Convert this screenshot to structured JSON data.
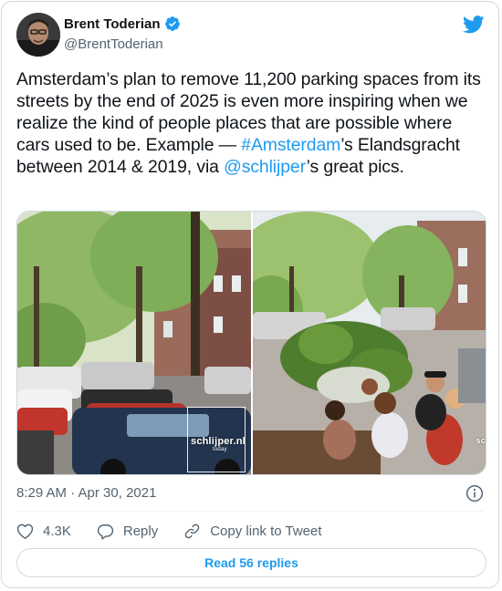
{
  "author": {
    "name": "Brent Toderian",
    "handle": "@BrentToderian"
  },
  "tweet": {
    "text_before": "Amsterdam’s plan to remove 11,200 parking spaces from its streets by the end of 2025 is even more inspiring when we realize the kind of people places that are possible where cars used to be. Example — ",
    "hashtag": "#Amsterdam",
    "text_middle": "’s Elandsgracht between 2014 & 2019, via ",
    "mention": "@schlijper",
    "text_after": "’s great pics."
  },
  "media": {
    "left_watermark": "schlijper.nl",
    "left_watermark_sub": "today",
    "right_watermark": "sc"
  },
  "timestamp": "8:29 AM · Apr 30, 2021",
  "actions": {
    "like_count": "4.3K",
    "reply_label": "Reply",
    "copy_label": "Copy link to Tweet"
  },
  "read_replies_label": "Read 56 replies",
  "colors": {
    "accent": "#1d9bf0",
    "text": "#0f1419",
    "muted": "#536471"
  }
}
